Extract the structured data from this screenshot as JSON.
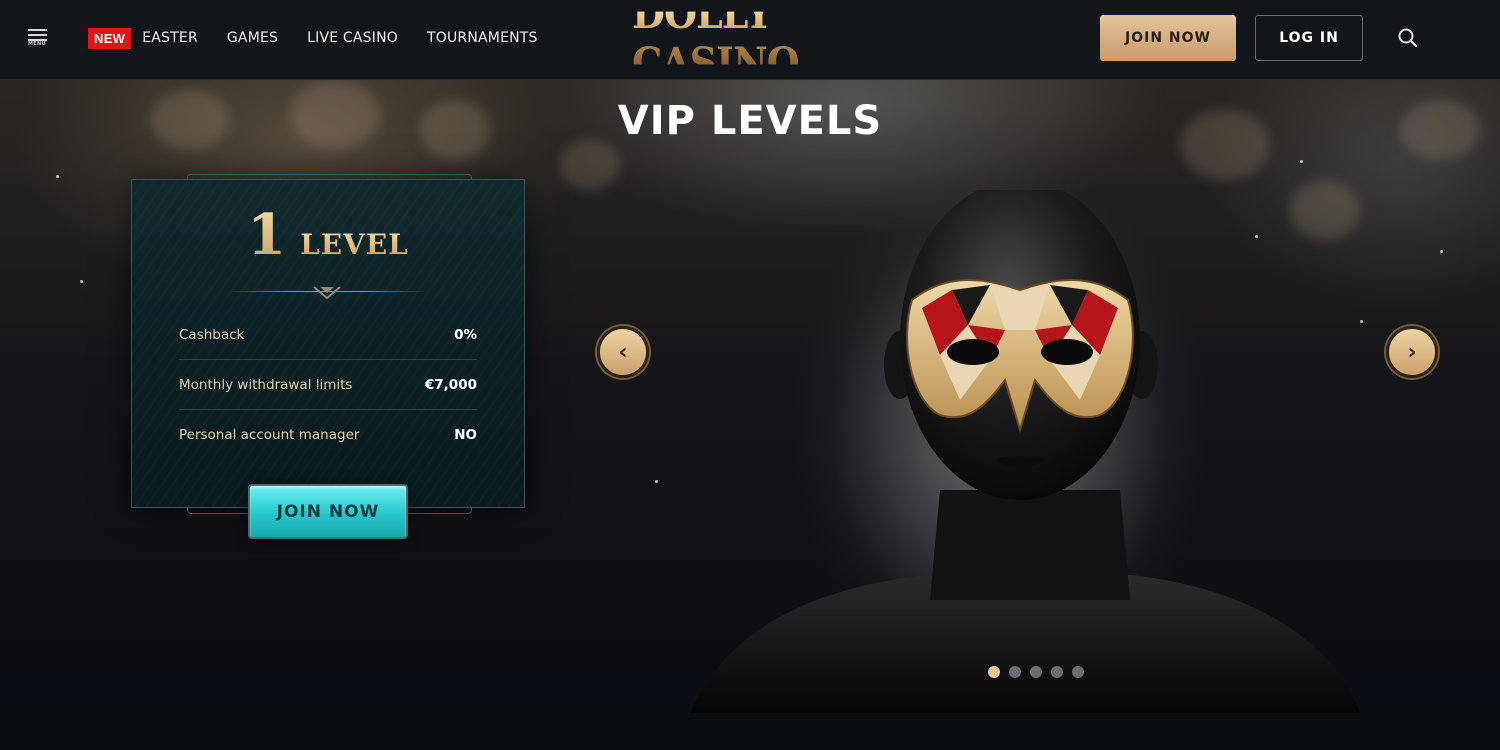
{
  "header": {
    "menu_label": "MENU",
    "badge": "NEW",
    "nav": [
      "EASTER",
      "GAMES",
      "LIVE CASINO",
      "TOURNAMENTS"
    ],
    "logo_text": "DOLLY CASINO",
    "join_label": "JOIN NOW",
    "login_label": "LOG IN",
    "search_icon": "search-icon"
  },
  "hero": {
    "title": "VIP LEVELS",
    "card": {
      "level_number": "1",
      "level_word": "LEVEL",
      "rows": [
        {
          "label": "Cashback",
          "value": "0%"
        },
        {
          "label": "Monthly withdrawal limits",
          "value": "€7,000"
        },
        {
          "label": "Personal account manager",
          "value": "NO"
        }
      ],
      "join_label": "JOIN NOW"
    },
    "prev_arrow": "‹",
    "next_arrow": "›",
    "slides_count": 5,
    "active_slide": 1
  },
  "colors": {
    "gold": "#c9a56a",
    "join_top_bg": "#d8b283",
    "card_button_teal": "#25c7cc",
    "new_badge": "#e0141b"
  }
}
